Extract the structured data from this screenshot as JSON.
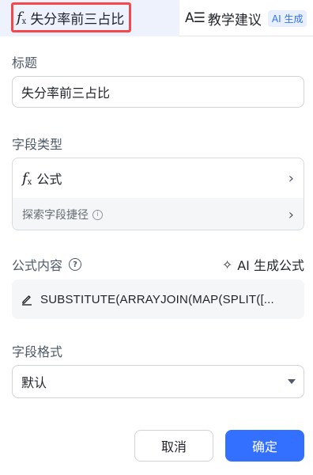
{
  "tabs": {
    "formula_tab": {
      "icon": "fx-icon",
      "label": "失分率前三占比"
    },
    "suggestion_tab": {
      "icon": "text-align-icon",
      "label": "教学建议",
      "badge": "AI 生成"
    }
  },
  "title_section": {
    "label": "标题",
    "value": "失分率前三占比"
  },
  "field_type_section": {
    "label": "字段类型",
    "type_name": "公式",
    "explore_label": "探索字段捷径"
  },
  "formula_section": {
    "label": "公式内容",
    "ai_generate_label": "AI 生成公式",
    "formula_text": "SUBSTITUTE(ARRAYJOIN(MAP(SPLIT([..."
  },
  "format_section": {
    "label": "字段格式",
    "selected": "默认"
  },
  "actions": {
    "cancel_label": "取消",
    "confirm_label": "确定"
  },
  "colors": {
    "accent": "#3370ff",
    "highlight_frame": "#f5484a",
    "active_tab_bg": "#eef2fd"
  }
}
